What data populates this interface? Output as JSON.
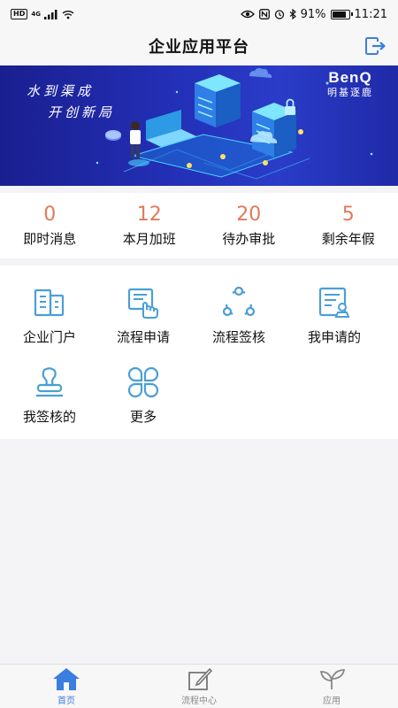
{
  "status_bar": {
    "hd": "HD",
    "net": "4G",
    "battery_percent": "91%",
    "battery_level": 0.91,
    "time": "11:21"
  },
  "header": {
    "title": "企业应用平台",
    "logout_icon": "logout-icon"
  },
  "banner": {
    "slogan_line1": "水到渠成",
    "slogan_line2": "开创新局",
    "brand_name": "BenQ",
    "brand_sub": "明基逐鹿",
    "colors": {
      "bg": "#2330b8",
      "accent": "#49d6ff"
    }
  },
  "stats": [
    {
      "value": "0",
      "label": "即时消息"
    },
    {
      "value": "12",
      "label": "本月加班"
    },
    {
      "value": "20",
      "label": "待办审批"
    },
    {
      "value": "5",
      "label": "剩余年假"
    }
  ],
  "apps": [
    {
      "label": "企业门户",
      "icon": "building-icon"
    },
    {
      "label": "流程申请",
      "icon": "hand-document-icon"
    },
    {
      "label": "流程签核",
      "icon": "workflow-cycle-icon"
    },
    {
      "label": "我申请的",
      "icon": "document-seal-icon"
    },
    {
      "label": "我签核的",
      "icon": "stamp-icon"
    },
    {
      "label": "更多",
      "icon": "more-grid-icon"
    }
  ],
  "tabbar": [
    {
      "label": "首页",
      "icon": "home-icon",
      "active": true
    },
    {
      "label": "流程中心",
      "icon": "edit-icon",
      "active": false
    },
    {
      "label": "应用",
      "icon": "sprout-icon",
      "active": false
    }
  ],
  "colors": {
    "accent_blue": "#3a7ee0",
    "stat_orange": "#e07a5a",
    "icon_blue": "#4a9fd6"
  }
}
